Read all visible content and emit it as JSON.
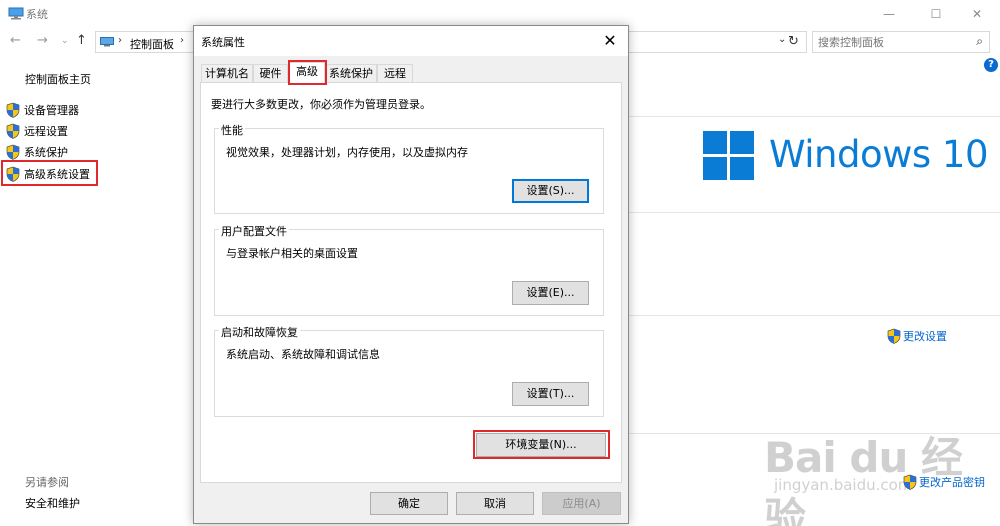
{
  "window": {
    "title": "系统",
    "controls": {
      "minimize": "—",
      "maximize": "☐",
      "close": "✕"
    }
  },
  "nav": {
    "breadcrumb": "控制面板",
    "search_placeholder": "搜索控制面板"
  },
  "sidebar": {
    "home": "控制面板主页",
    "links": [
      {
        "label": "设备管理器"
      },
      {
        "label": "远程设置"
      },
      {
        "label": "系统保护"
      },
      {
        "label": "高级系统设置"
      }
    ],
    "see_also": "另请参阅",
    "security": "安全和维护"
  },
  "main": {
    "logo_text": "Windows 10",
    "change_settings": "更改设置",
    "change_product_key": "更改产品密钥"
  },
  "watermark": {
    "main": "Bai du 经验",
    "sub": "jingyan.baidu.com"
  },
  "dialog": {
    "title": "系统属性",
    "close": "✕",
    "tabs": [
      {
        "label": "计算机名"
      },
      {
        "label": "硬件"
      },
      {
        "label": "高级"
      },
      {
        "label": "系统保护"
      },
      {
        "label": "远程"
      }
    ],
    "active_tab": "高级",
    "admin_note": "要进行大多数更改，你必须作为管理员登录。",
    "groups": {
      "performance": {
        "label": "性能",
        "desc": "视觉效果，处理器计划，内存使用，以及虚拟内存",
        "button": "设置(S)..."
      },
      "profile": {
        "label": "用户配置文件",
        "desc": "与登录帐户相关的桌面设置",
        "button": "设置(E)..."
      },
      "startup": {
        "label": "启动和故障恢复",
        "desc": "系统启动、系统故障和调试信息",
        "button": "设置(T)..."
      }
    },
    "env_button": "环境变量(N)...",
    "ok": "确定",
    "cancel": "取消",
    "apply": "应用(A)"
  },
  "colors": {
    "accent_blue": "#0a7cd6",
    "link_blue": "#0066cc",
    "highlight_red": "#e0292f"
  }
}
